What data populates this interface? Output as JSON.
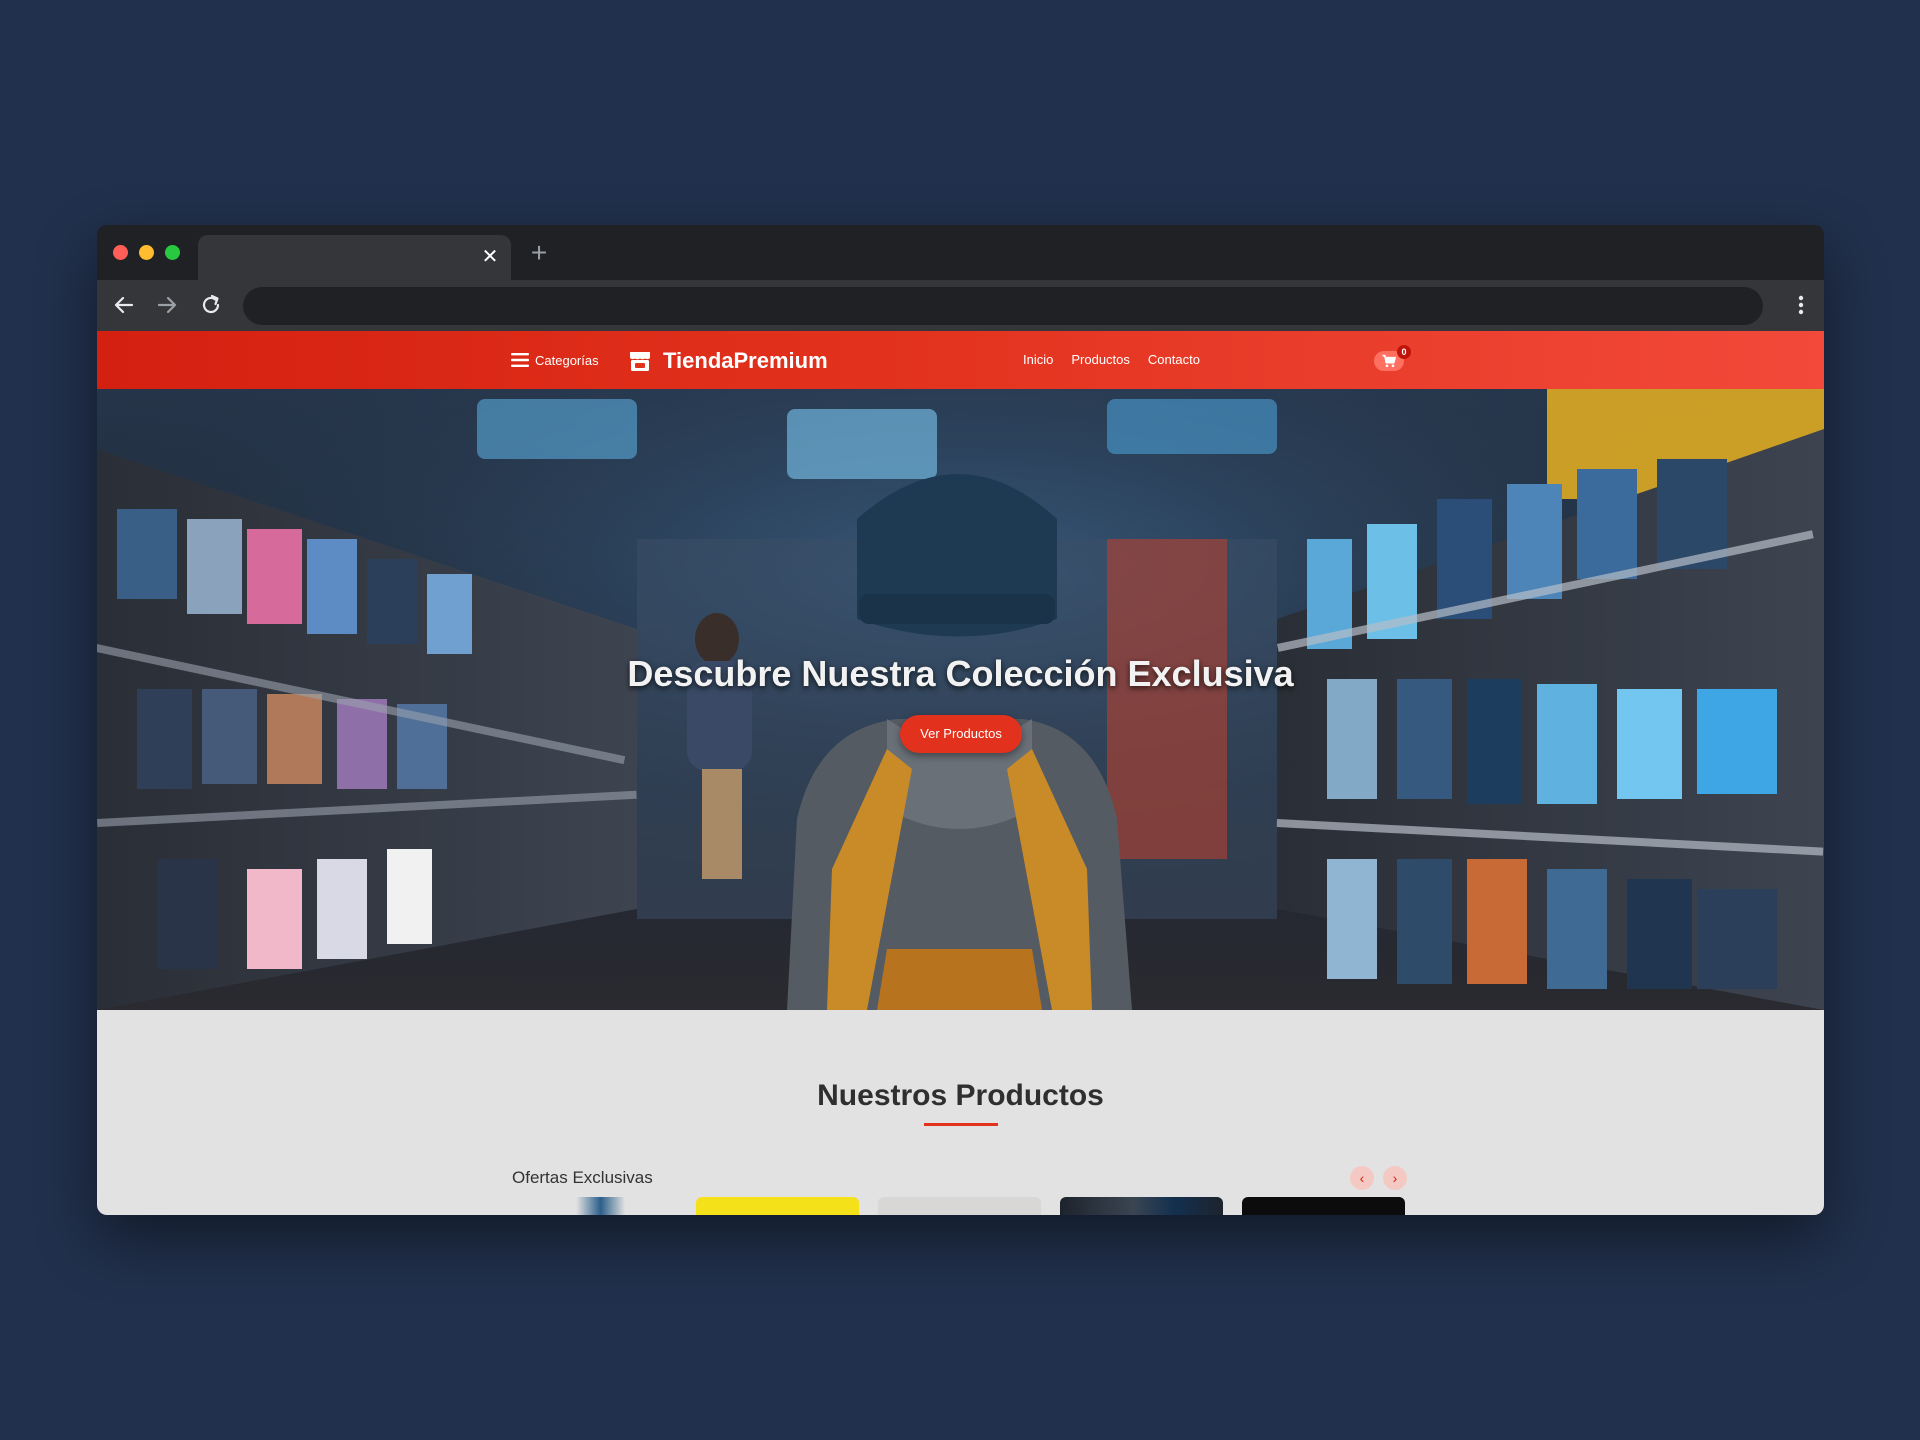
{
  "browser": {
    "tab_title": "",
    "tab_close": "✕",
    "new_tab": "+",
    "address": ""
  },
  "header": {
    "categories_label": "Categorías",
    "brand_name": "TiendaPremium",
    "nav": [
      "Inicio",
      "Productos",
      "Contacto"
    ],
    "cart_count": "0"
  },
  "hero": {
    "title": "Descubre Nuestra Colección Exclusiva",
    "cta_label": "Ver Productos"
  },
  "products": {
    "section_title": "Nuestros Productos",
    "offers_label": "Ofertas Exclusivas",
    "prev_icon": "‹",
    "next_icon": "›"
  },
  "icons": {
    "menu": "hamburger-icon",
    "brand": "store-icon",
    "cart": "shopping-cart-icon",
    "back": "arrow-left-icon",
    "forward": "arrow-right-icon",
    "reload": "reload-icon",
    "browser_menu": "kebab-menu-icon"
  },
  "colors": {
    "page_background": "#21304c",
    "brand_red": "#e2321d",
    "header_gradient_start": "#d42010",
    "header_gradient_end": "#f2493a",
    "content_background": "#e2e2e2"
  }
}
